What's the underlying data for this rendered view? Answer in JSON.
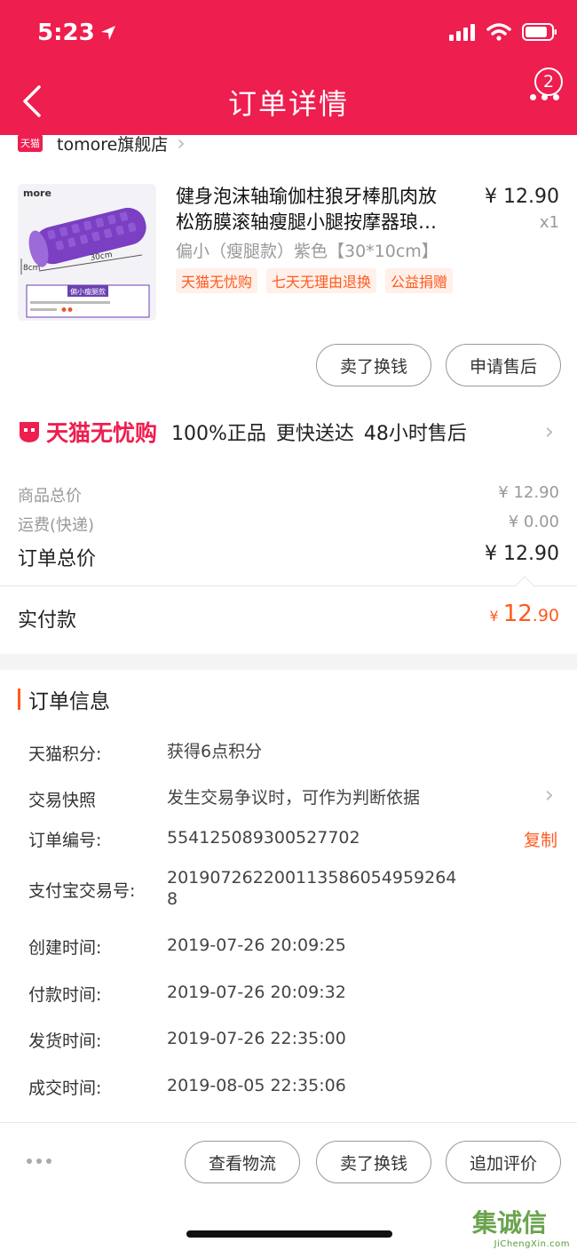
{
  "status_bar": {
    "time": "5:23"
  },
  "header": {
    "title": "订单详情",
    "badge_count": "2"
  },
  "shop": {
    "tag": "天猫",
    "name": "tomore旗舰店"
  },
  "product": {
    "title_line1": "健身泡沫轴瑜伽柱狼牙棒肌肉放",
    "title_line2": "松筋膜滚轴瘦腿小腿按摩器琅…",
    "price": "¥ 12.90",
    "qty": "x1",
    "spec": "偏小（瘦腿款）紫色【30*10cm】",
    "tags": [
      "天猫无忧购",
      "七天无理由退换",
      "公益捐赠"
    ],
    "image": {
      "brand": "more",
      "dim_width": "30cm",
      "dim_height": "8cm",
      "caption": "偏小瘦腿款"
    }
  },
  "item_actions": {
    "sell": "卖了换钱",
    "after_sale": "申请售后"
  },
  "worry_free": {
    "logo": "天猫无忧购",
    "text": "100%正品  更快送达  48小时售后"
  },
  "pricing": {
    "goods_label": "商品总价",
    "goods_value": "¥ 12.90",
    "shipping_label": "运费(快递)",
    "shipping_value": "¥ 0.00",
    "total_label": "订单总价",
    "total_value": "¥ 12.90",
    "paid_label": "实付款",
    "paid_currency": "¥",
    "paid_int": "12",
    "paid_dec": ".90"
  },
  "order_info": {
    "title": "订单信息",
    "points_label": "天猫积分:",
    "points_value": "获得6点积分",
    "snapshot_label": "交易快照",
    "snapshot_value": "发生交易争议时，可作为判断依据",
    "order_no_label": "订单编号:",
    "order_no_value": "554125089300527702",
    "copy_label": "复制",
    "alipay_label": "支付宝交易号:",
    "alipay_line1": "201907262200113586054959264",
    "alipay_line2": "8",
    "created_label": "创建时间:",
    "created_value": "2019-07-26 20:09:25",
    "paid_time_label": "付款时间:",
    "paid_time_value": "2019-07-26 20:09:32",
    "shipped_label": "发货时间:",
    "shipped_value": "2019-07-26 22:35:00",
    "done_label": "成交时间:",
    "done_value": "2019-08-05 22:35:06"
  },
  "bottom_actions": {
    "logistics": "查看物流",
    "sell": "卖了换钱",
    "review": "追加评价"
  },
  "watermark": {
    "main": "集诚信",
    "sub": "JiChengXin.com"
  },
  "colors": {
    "brand": "#ee1e4f",
    "accent": "#ff5a1f"
  }
}
